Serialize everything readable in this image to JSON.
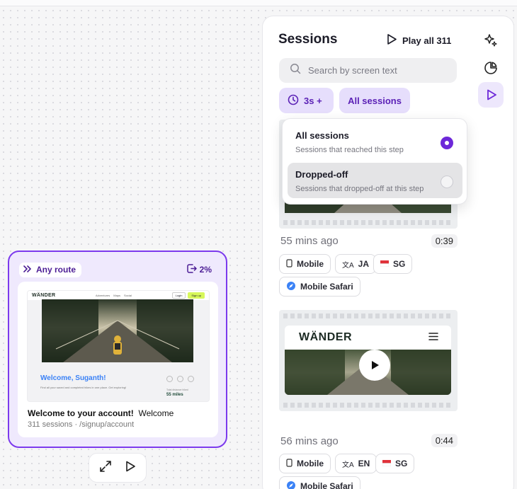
{
  "step_card": {
    "route_label": "Any route",
    "dropoff": "2%",
    "thumbnail": {
      "logo": "WÄNDER",
      "nav_links": [
        "Adventures",
        "Maps",
        "Social"
      ],
      "login": "Login",
      "signup": "Sign up",
      "welcome": "Welcome, Suganth!",
      "subtitle": "Find all your saved and completed hikes in one place. Get exploring!",
      "stat_label": "Total distance hiked",
      "stat_value": "55 miles"
    },
    "title_bold": "Welcome to your account!",
    "title_rest": "Welcome",
    "meta": "311 sessions · /signup/account"
  },
  "sessions": {
    "title": "Sessions",
    "play_all": "Play all 311",
    "search_placeholder": "Search by screen text",
    "filter_time": "3s +",
    "filter_scope": "All sessions",
    "dropdown": [
      {
        "label": "All sessions",
        "desc": "Sessions that reached this step",
        "selected": true
      },
      {
        "label": "Dropped-off",
        "desc": "Sessions that dropped-off at this step",
        "selected": false
      }
    ],
    "items": [
      {
        "time": "55 mins ago",
        "duration": "0:39",
        "device": "Mobile",
        "lang": "JA",
        "country": "SG",
        "browser": "Mobile Safari"
      },
      {
        "time": "56 mins ago",
        "duration": "0:44",
        "device": "Mobile",
        "lang": "EN",
        "country": "SG",
        "browser": "Mobile Safari",
        "logo": "WÄNDER"
      }
    ]
  },
  "colors": {
    "accent": "#7c3aed",
    "accent_bg": "#e6defc",
    "card_bg": "#efe9fd"
  },
  "icons": [
    "route-icon",
    "exit-icon",
    "expand-icon",
    "play-icon",
    "sparkle-icon",
    "pie-chart-icon",
    "play-circle-icon",
    "search-icon",
    "clock-icon",
    "mobile-icon",
    "translate-icon",
    "flag-icon",
    "safari-icon",
    "menu-icon"
  ]
}
